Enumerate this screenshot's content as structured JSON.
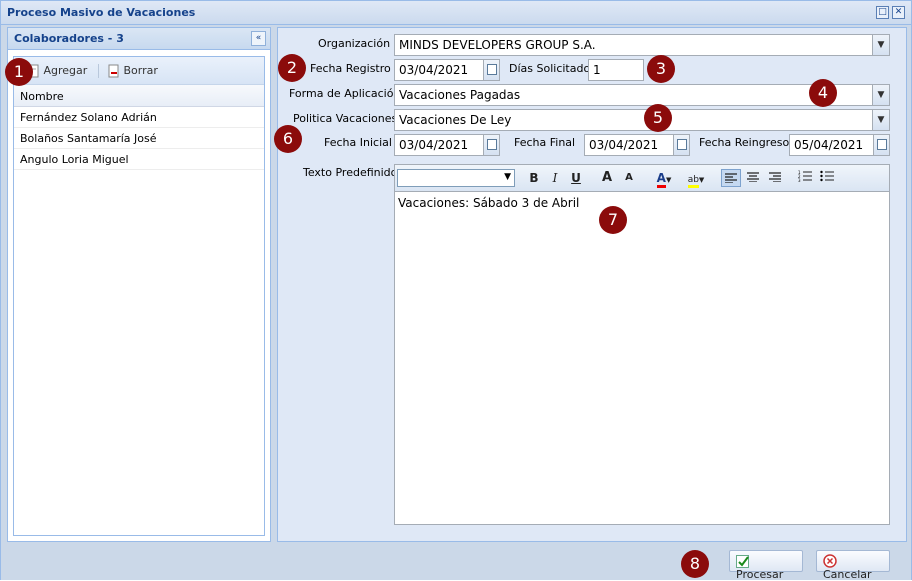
{
  "window": {
    "title": "Proceso Masivo de Vacaciones"
  },
  "left_panel": {
    "title": "Colaboradores - 3",
    "toolbar": {
      "add_label": "Agregar",
      "delete_label": "Borrar"
    },
    "grid": {
      "column": "Nombre",
      "rows": [
        "Fernández Solano Adrián",
        "Bolaños Santamaría José",
        "Angulo Loria Miguel"
      ]
    }
  },
  "form": {
    "organizacion": {
      "label": "Organización",
      "value": "MINDS DEVELOPERS GROUP S.A."
    },
    "fecha_registro": {
      "label": "Fecha Registro",
      "value": "03/04/2021"
    },
    "dias_solicitados": {
      "label": "Días Solicitados",
      "value": "1"
    },
    "forma_aplicacion": {
      "label": "Forma de Aplicación",
      "value": "Vacaciones Pagadas"
    },
    "politica": {
      "label": "Politica Vacaciones",
      "value": "Vacaciones De Ley"
    },
    "fecha_inicial": {
      "label": "Fecha Inicial",
      "value": "03/04/2021"
    },
    "fecha_final": {
      "label": "Fecha Final",
      "value": "03/04/2021"
    },
    "fecha_reingreso": {
      "label": "Fecha Reingreso",
      "value": "05/04/2021"
    },
    "texto_predefinido": {
      "label": "Texto Predefinido",
      "content": "Vacaciones: Sábado 3 de Abril"
    }
  },
  "editor_toolbar": {
    "bold": "B",
    "italic": "I",
    "underline": "U",
    "grow": "A",
    "shrink": "A",
    "font_color": "A",
    "highlight": "ab"
  },
  "footer": {
    "process_label": "Procesar",
    "cancel_label": "Cancelar"
  },
  "badges": [
    "1",
    "2",
    "3",
    "4",
    "5",
    "6",
    "7",
    "8"
  ],
  "colors": {
    "title_text": "#15428b",
    "badge": "#8b0b0b",
    "panel_border": "#99bbe8"
  }
}
